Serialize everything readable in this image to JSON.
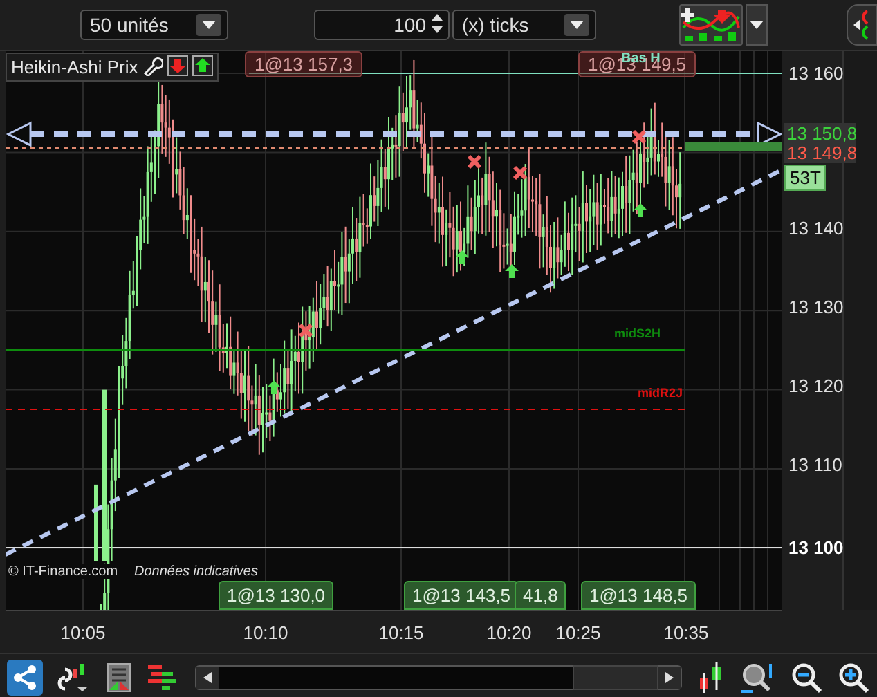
{
  "toolbar": {
    "period": "50 unités",
    "count": "100",
    "unit": "(x) ticks"
  },
  "chart": {
    "title": "Heikin-Ashi Prix",
    "top_orders": [
      {
        "label": "1@13 157,3"
      },
      {
        "label": "1@13 149,5"
      }
    ],
    "marker_label": "Bas H",
    "price_ticks": [
      "13 160",
      "13 140",
      "13 130",
      "13 120",
      "13 110",
      "13 100"
    ],
    "price_tags": [
      {
        "label": "13 150,8",
        "color": "#3cd23c"
      },
      {
        "label": "13 149,8",
        "color": "#ff5a4a"
      }
    ],
    "timer": "53T",
    "levels": [
      {
        "label": "midS2H",
        "color": "#0e8c0e"
      },
      {
        "label": "midR2J",
        "color": "#e01010"
      }
    ],
    "bottom_orders": [
      {
        "label": "1@13 130,0"
      },
      {
        "label": "1@13 143,5"
      },
      {
        "label": "41,8"
      },
      {
        "label": "1@13 148,5"
      }
    ],
    "copyright": "© IT-Finance.com",
    "disclaimer": "Données indicatives"
  },
  "time_axis": [
    "10:05",
    "10:10",
    "10:15",
    "10:20",
    "10:25",
    "10:35"
  ]
}
